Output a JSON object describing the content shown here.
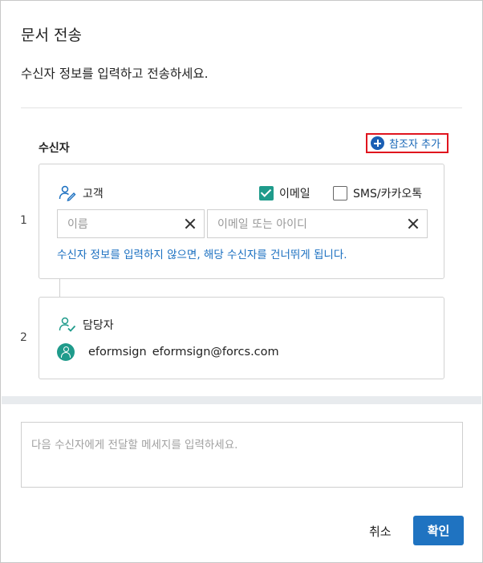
{
  "dialog": {
    "title": "문서 전송",
    "subtitle": "수신자 정보를 입력하고 전송하세요."
  },
  "recipients": {
    "heading": "수신자",
    "add_cc_label": "참조자 추가",
    "customer": {
      "number": "1",
      "role_label": "고객",
      "email_option": {
        "label": "이메일",
        "checked": true
      },
      "sms_option": {
        "label": "SMS/카카오톡",
        "checked": false
      },
      "name_placeholder": "이름",
      "email_placeholder": "이메일 또는 아이디",
      "hint": "수신자 정보를 입력하지 않으면, 해당 수신자를 건너뛰게 됩니다."
    },
    "manager": {
      "number": "2",
      "role_label": "담당자",
      "user_name": "eformsign",
      "user_email": "eformsign@forcs.com"
    }
  },
  "message": {
    "placeholder": "다음 수신자에게 전달할 메세지를 입력하세요."
  },
  "footer": {
    "cancel_label": "취소",
    "confirm_label": "확인"
  },
  "colors": {
    "accent": "#1f73c1",
    "teal": "#1f9b8b",
    "link": "#1a6fc0",
    "highlight_border": "#e0141e"
  }
}
